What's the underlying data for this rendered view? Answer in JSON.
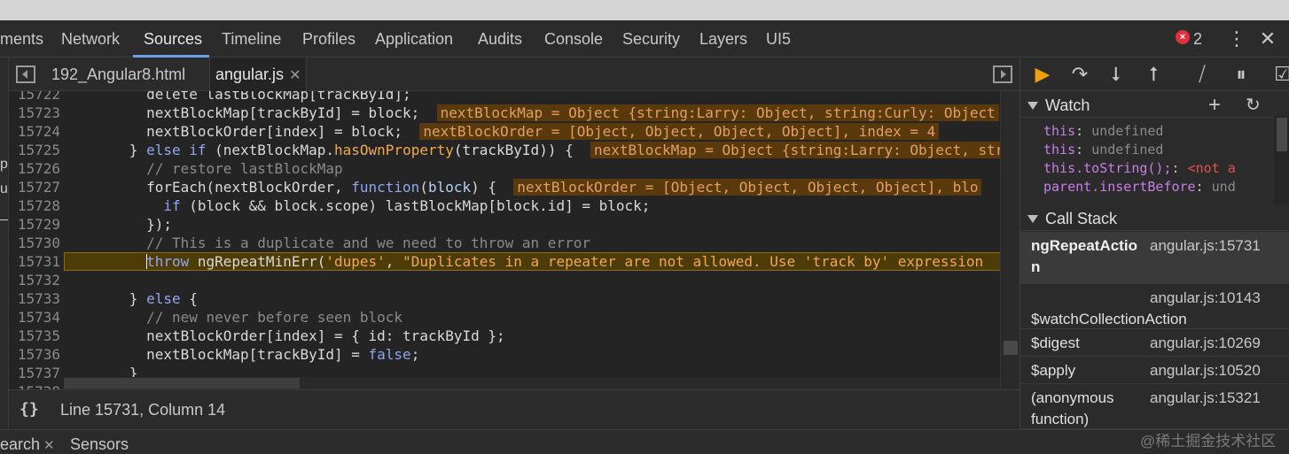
{
  "main_tabs": [
    {
      "label": "ments"
    },
    {
      "label": "Network"
    },
    {
      "label": "Sources"
    },
    {
      "label": "Timeline"
    },
    {
      "label": "Profiles"
    },
    {
      "label": "Application"
    },
    {
      "label": "Audits"
    },
    {
      "label": "Console"
    },
    {
      "label": "Security"
    },
    {
      "label": "Layers"
    },
    {
      "label": "UI5"
    }
  ],
  "error_count": "2",
  "left_strip": [
    "p",
    "ul",
    "_A"
  ],
  "file_tabs": [
    {
      "label": "192_Angular8.html"
    },
    {
      "label": "angular.js"
    }
  ],
  "code_lines": [
    {
      "num": "15722",
      "tokens": [
        {
          "t": "m",
          "v": "        delete lastBlockMap[trackById];"
        }
      ]
    },
    {
      "num": "15723",
      "tokens": [
        {
          "t": "m",
          "v": "        nextBlockMap[trackById] = block;  "
        },
        {
          "t": "inline-val",
          "v": "nextBlockMap = Object {string:Larry: Object, string:Curly: Object"
        }
      ]
    },
    {
      "num": "15724",
      "tokens": [
        {
          "t": "m",
          "v": "        nextBlockOrder[index] = block;  "
        },
        {
          "t": "inline-val",
          "v": "nextBlockOrder = [Object, Object, Object, Object], index = 4"
        }
      ]
    },
    {
      "num": "15725",
      "tokens": [
        {
          "t": "m",
          "v": "      } "
        },
        {
          "t": "k",
          "v": "else if"
        },
        {
          "t": "m",
          "v": " (nextBlockMap."
        },
        {
          "t": "s",
          "v": "hasOwnProperty"
        },
        {
          "t": "m",
          "v": "(trackById)) {  "
        },
        {
          "t": "inline-val",
          "v": "nextBlockMap = Object {string:Larry: Object, string:Curly"
        }
      ]
    },
    {
      "num": "15726",
      "tokens": [
        {
          "t": "c",
          "v": "        // restore lastBlockMap"
        }
      ]
    },
    {
      "num": "15727",
      "tokens": [
        {
          "t": "m",
          "v": "        forEach(nextBlockOrder, "
        },
        {
          "t": "k",
          "v": "function"
        },
        {
          "t": "m",
          "v": "("
        },
        {
          "t": "v",
          "v": "block"
        },
        {
          "t": "m",
          "v": ") {  "
        },
        {
          "t": "inline-val",
          "v": "nextBlockOrder = [Object, Object, Object, Object], blo"
        }
      ]
    },
    {
      "num": "15728",
      "tokens": [
        {
          "t": "m",
          "v": "          "
        },
        {
          "t": "k",
          "v": "if"
        },
        {
          "t": "m",
          "v": " (block && block.scope) lastBlockMap[block.id] = block;"
        }
      ]
    },
    {
      "num": "15729",
      "tokens": [
        {
          "t": "m",
          "v": "        });"
        }
      ]
    },
    {
      "num": "15730",
      "tokens": [
        {
          "t": "c",
          "v": "        // This is a duplicate and we need to throw an error"
        }
      ]
    },
    {
      "num": "15731",
      "current": true,
      "tokens": [
        {
          "t": "m",
          "v": "        "
        },
        {
          "t": "k",
          "v": "throw"
        },
        {
          "t": "m",
          "v": " ngRepeatMinErr("
        },
        {
          "t": "s",
          "v": "'dupes'"
        },
        {
          "t": "m",
          "v": ", "
        },
        {
          "t": "s",
          "v": "\"Duplicates in a repeater are not allowed. Use 'track by' expression"
        }
      ]
    },
    {
      "num": "15732",
      "tokens": [
        {
          "t": "m",
          "v": ""
        }
      ]
    },
    {
      "num": "15733",
      "tokens": [
        {
          "t": "m",
          "v": "      } "
        },
        {
          "t": "k",
          "v": "else"
        },
        {
          "t": "m",
          "v": " {"
        }
      ]
    },
    {
      "num": "15734",
      "tokens": [
        {
          "t": "c",
          "v": "        // new never before seen block"
        }
      ]
    },
    {
      "num": "15735",
      "tokens": [
        {
          "t": "m",
          "v": "        nextBlockOrder[index] = { id: trackById };"
        }
      ]
    },
    {
      "num": "15736",
      "tokens": [
        {
          "t": "m",
          "v": "        nextBlockMap[trackById] = "
        },
        {
          "t": "k",
          "v": "false"
        },
        {
          "t": "m",
          "v": ";"
        }
      ]
    },
    {
      "num": "15737",
      "tokens": [
        {
          "t": "m",
          "v": "      }"
        }
      ]
    },
    {
      "num": "15738",
      "tokens": [
        {
          "t": "m",
          "v": ""
        }
      ]
    }
  ],
  "status": {
    "format_icon": "{}",
    "position": "Line 15731, Column 14"
  },
  "watch": {
    "title": "Watch",
    "items": [
      {
        "expr": "this",
        "value": "undefined",
        "error": false
      },
      {
        "expr": "this",
        "value": "undefined",
        "error": false
      },
      {
        "expr": "this.toString();",
        "value": "<not a",
        "error": true
      },
      {
        "expr": "parent.insertBefore",
        "value": "und",
        "error": false
      }
    ]
  },
  "call_stack": {
    "title": "Call Stack",
    "frames": [
      {
        "fn": "ngRepeatActio\nn",
        "loc": "angular.js:15731",
        "selected": true
      },
      {
        "fn": "$watchCollectionAction",
        "loc": "angular.js:10143",
        "selected": false
      },
      {
        "fn": "$digest",
        "loc": "angular.js:10269",
        "selected": false
      },
      {
        "fn": "$apply",
        "loc": "angular.js:10520",
        "selected": false
      },
      {
        "fn": "(anonymous\nfunction)",
        "loc": "angular.js:15321",
        "selected": false
      }
    ]
  },
  "drawer_tabs": [
    {
      "label": "earch"
    },
    {
      "label": "Sensors"
    }
  ],
  "watermark": "@稀土掘金技术社区",
  "colors": {
    "accent": "#6aa0e8",
    "pause_highlight": "#4d3b08",
    "error": "#e0303a",
    "resume": "#f0a000"
  }
}
